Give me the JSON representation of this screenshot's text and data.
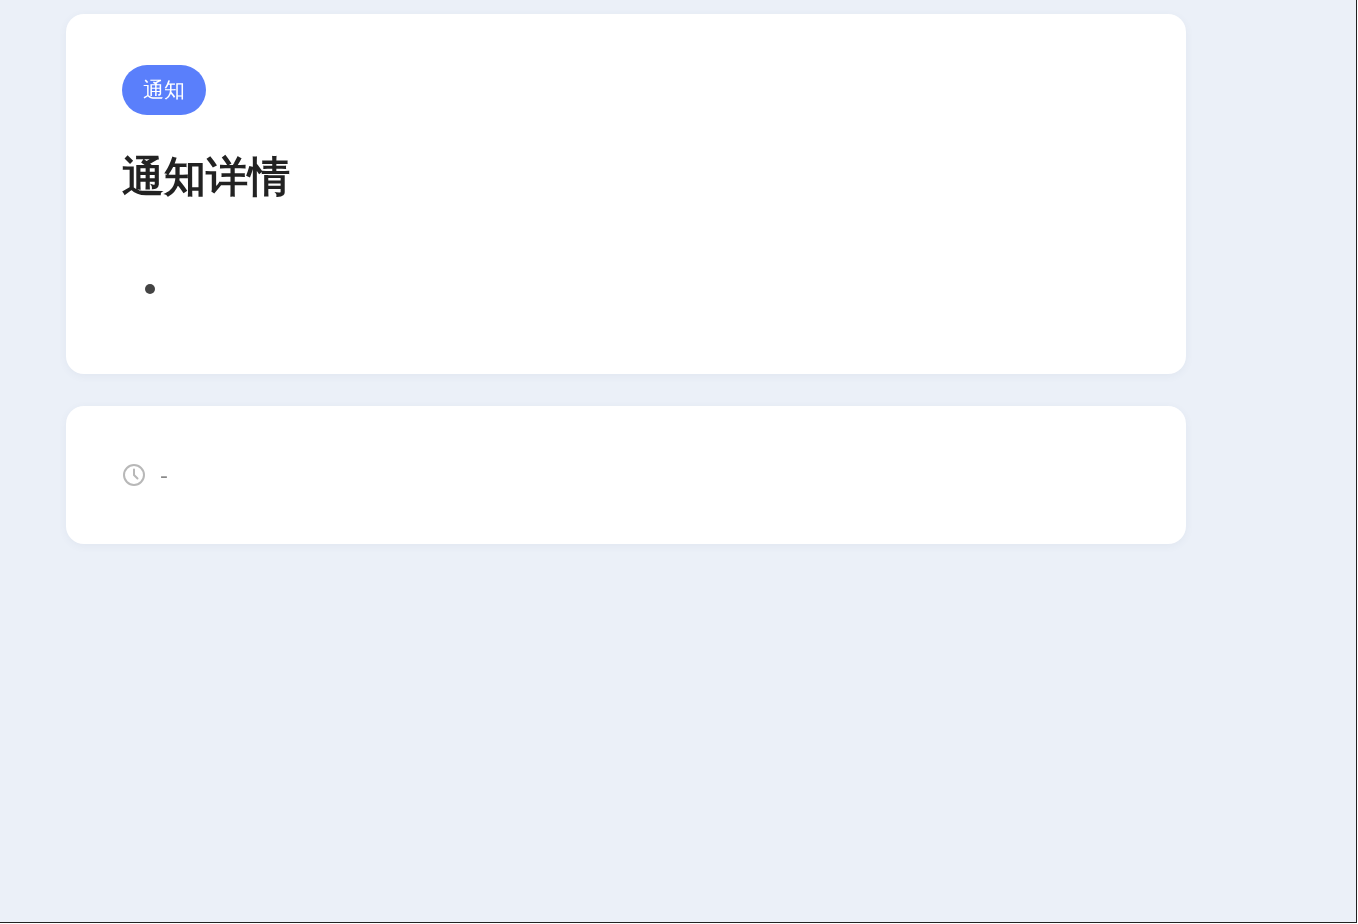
{
  "notice": {
    "tag": "通知",
    "title": "通知详情"
  },
  "meta": {
    "time": "-"
  }
}
